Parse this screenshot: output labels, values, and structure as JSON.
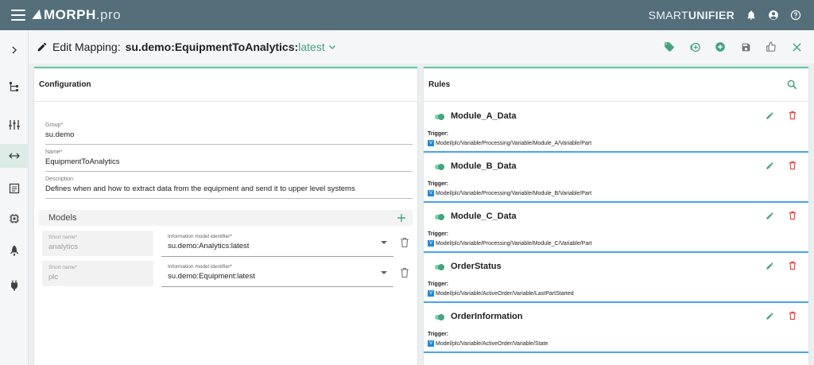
{
  "topbar": {
    "logo_main": "MORPH",
    "logo_suffix": ".pro",
    "product_light": "SMART",
    "product_bold": "UNIFIER"
  },
  "header": {
    "label": "Edit Mapping:",
    "name": "su.demo:EquipmentToAnalytics:",
    "version": "latest"
  },
  "configuration": {
    "title": "Configuration",
    "group": {
      "label": "Group*",
      "value": "su.demo"
    },
    "name": {
      "label": "Name*",
      "value": "EquipmentToAnalytics"
    },
    "description": {
      "label": "Description",
      "value": "Defines when and how to extract data from the equipment and send it to upper level systems"
    },
    "models_title": "Models",
    "models": [
      {
        "short_label": "Short name*",
        "short_value": "analytics",
        "ident_label": "Information model identifier*",
        "ident_value": "su.demo:Analytics:latest"
      },
      {
        "short_label": "Short name*",
        "short_value": "plc",
        "ident_label": "Information model identifier*",
        "ident_value": "su.demo:Equipment:latest"
      }
    ]
  },
  "rules": {
    "title": "Rules",
    "trigger_label": "Trigger:",
    "items": [
      {
        "name": "Module_A_Data",
        "path": "Model/plc/Variable/Processing/Variable/Module_A/Variable/Part"
      },
      {
        "name": "Module_B_Data",
        "path": "Model/plc/Variable/Processing/Variable/Module_B/Variable/Part"
      },
      {
        "name": "Module_C_Data",
        "path": "Model/plc/Variable/Processing/Variable/Module_C/Variable/Part"
      },
      {
        "name": "OrderStatus",
        "path": "Model/plc/Variable/ActiveOrder/Variable/LastPartStarted"
      },
      {
        "name": "OrderInformation",
        "path": "Model/plc/Variable/ActiveOrder/Variable/State"
      }
    ],
    "badge": "V"
  },
  "colors": {
    "accent": "#43a47f",
    "topbar": "#546e7a",
    "rule_border": "#42a5f5",
    "delete": "#e53935"
  },
  "icons": [
    "menu-icon",
    "bell-icon",
    "account-icon",
    "help-icon",
    "chevron-right-icon",
    "tree-icon",
    "sliders-icon",
    "mapping-icon",
    "document-icon",
    "chip-icon",
    "rocket-icon",
    "plug-icon",
    "pencil-icon",
    "chevron-down-icon",
    "tag-icon",
    "add-circle-outline-icon",
    "add-circle-icon",
    "save-icon",
    "thumb-up-icon",
    "close-icon",
    "search-icon",
    "plus-icon",
    "trash-icon",
    "toggle-icon"
  ]
}
